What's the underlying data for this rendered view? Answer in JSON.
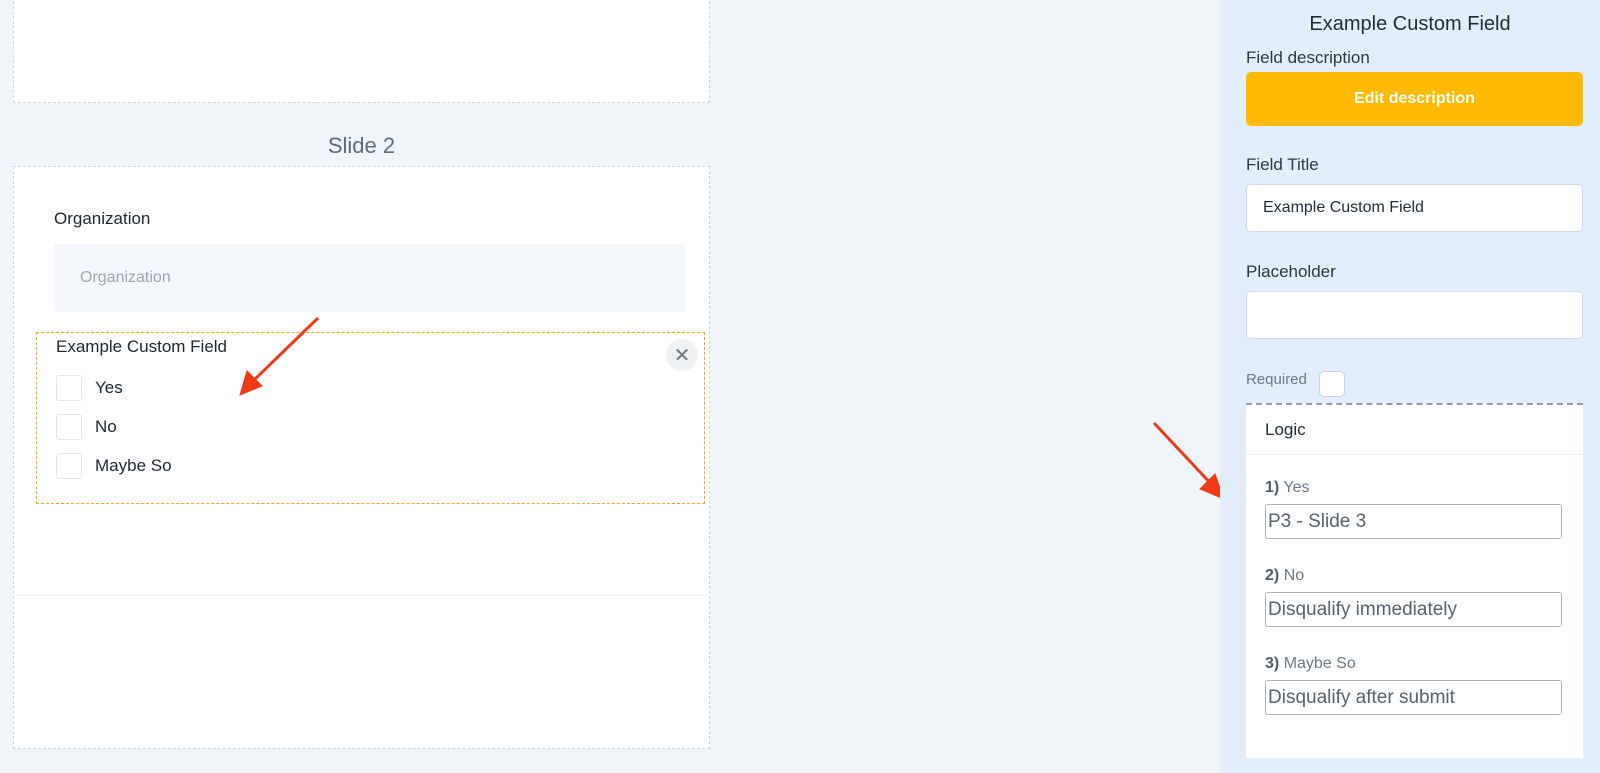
{
  "slide": {
    "title": "Slide 2",
    "organization": {
      "label": "Organization",
      "placeholder": "Organization"
    },
    "custom_field": {
      "label": "Example Custom Field",
      "close_icon": "close-icon",
      "options": [
        "Yes",
        "No",
        "Maybe So"
      ]
    }
  },
  "panel": {
    "title": "Example Custom Field",
    "field_description_label": "Field description",
    "edit_description_button": "Edit description",
    "field_title_label": "Field Title",
    "field_title_value": "Example Custom Field",
    "placeholder_label": "Placeholder",
    "placeholder_value": "",
    "required_label": "Required",
    "logic": {
      "heading": "Logic",
      "rules": [
        {
          "num": "1)",
          "option": "Yes",
          "action": "P3 - Slide 3"
        },
        {
          "num": "2)",
          "option": "No",
          "action": "Disqualify immediately"
        },
        {
          "num": "3)",
          "option": "Maybe So",
          "action": "Disqualify after submit"
        }
      ]
    }
  },
  "colors": {
    "accent": "#ffba00",
    "selection_border": "#f5a623",
    "annotation_arrow": "#f03a17",
    "panel_bg": "#e2eefb",
    "canvas_bg": "#f0f5f9"
  }
}
